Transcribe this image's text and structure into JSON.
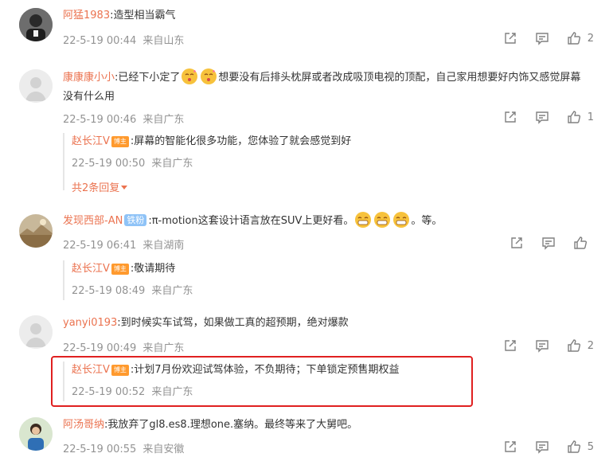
{
  "colors": {
    "name": "#eb7350",
    "meta": "#939393",
    "highlight": "#e02020",
    "badge_boss": "#ff9a2e",
    "badge_fan": "#8fc3f7"
  },
  "comments": [
    {
      "name": "阿猛1983",
      "text": ":造型相当霸气",
      "time": "22-5-19 00:44",
      "location": "来自山东",
      "likes": "2"
    },
    {
      "name": "康康康小小",
      "text_before": ":已经下小定了",
      "text_after": "想要没有后排头枕屏或者改成吸顶电视的顶配，自己家用想要好内饰又感觉屏幕没有什么用",
      "time": "22-5-19 00:46",
      "location": "来自广东",
      "likes": "1",
      "reply": {
        "name": "赵长江V",
        "badge": "博主",
        "text": ":屏幕的智能化很多功能，您体验了就会感觉到好",
        "time": "22-5-19 00:50",
        "location": "来自广东"
      },
      "more_replies": "共2条回复"
    },
    {
      "name": "发现西部-AN",
      "badge": "铁粉",
      "text": ":π-motion这套设计语言放在SUV上更好看。",
      "text_after": "。等。",
      "time": "22-5-19 06:41",
      "location": "来自湖南",
      "likes": "",
      "reply": {
        "name": "赵长江V",
        "badge": "博主",
        "text": ":敬请期待",
        "time": "22-5-19 08:49",
        "location": "来自广东"
      }
    },
    {
      "name": "yanyi0193",
      "text": ":到时候实车试驾，如果做工真的超预期，绝对爆款",
      "time": "22-5-19 00:49",
      "location": "来自广东",
      "likes": "2",
      "reply": {
        "name": "赵长江V",
        "badge": "博主",
        "text": ":计划7月份欢迎试驾体验，不负期待；下单锁定预售期权益",
        "time": "22-5-19 00:52",
        "location": "来自广东"
      }
    },
    {
      "name": "阿汤哥纳",
      "text": ":我放弃了gl8.es8.理想one.塞纳。最终等来了大舅吧。",
      "time": "22-5-19 00:55",
      "location": "来自安徽",
      "likes": "5"
    }
  ]
}
